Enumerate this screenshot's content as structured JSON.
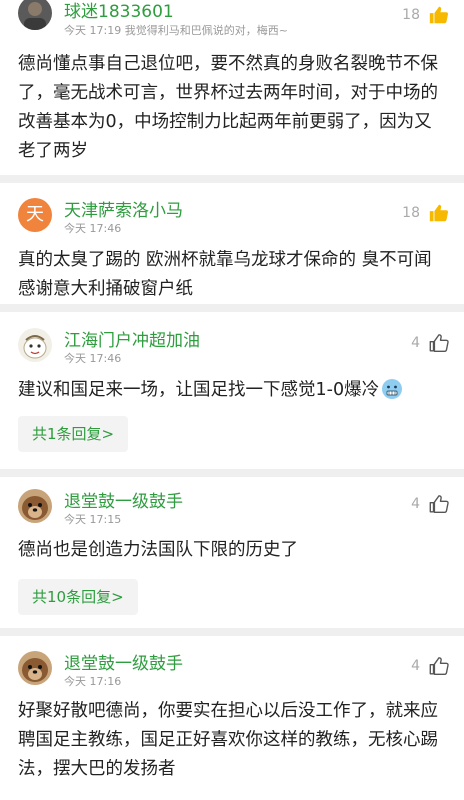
{
  "comments": [
    {
      "username": "球迷1833601",
      "time": "今天 17:19",
      "quote": "我觉得利马和巴佩说的对，梅西~",
      "likes": "18",
      "text": "德尚懂点事自己退位吧，要不然真的身败名裂晚节不保了，毫无战术可言，世界杯过去两年时间，对于中场的改善基本为0，中场控制力比起两年前更弱了，因为又老了两岁",
      "avatar": "photo-avatar"
    },
    {
      "username": "天津萨索洛小马",
      "time": "今天 17:46",
      "likes": "18",
      "text": "真的太臭了踢的 欧洲杯就靠乌龙球才保命的 臭不可闻 感谢意大利捅破窗户纸",
      "avatar_char": "天",
      "avatar_color": "#f0843c"
    },
    {
      "username": "江海门户冲超加油",
      "time": "今天 17:46",
      "likes": "4",
      "text": "建议和国足来一场，让国足找一下感觉1-0爆冷",
      "emoji": "cold-face-emoji",
      "replies": "共1条回复>"
    },
    {
      "username": "退堂鼓一级鼓手",
      "time": "今天 17:15",
      "likes": "4",
      "text": "德尚也是创造力法国队下限的历史了",
      "replies": "共10条回复>"
    },
    {
      "username": "退堂鼓一级鼓手",
      "time": "今天 17:16",
      "likes": "4",
      "text": "好聚好散吧德尚，你要实在担心以后没工作了，就来应聘国足主教练，国足正好喜欢你这样的教练，无核心踢法，摆大巴的发扬者"
    }
  ],
  "colors": {
    "username": "#2e9d3e",
    "meta": "#999999",
    "divider": "#efefef"
  }
}
